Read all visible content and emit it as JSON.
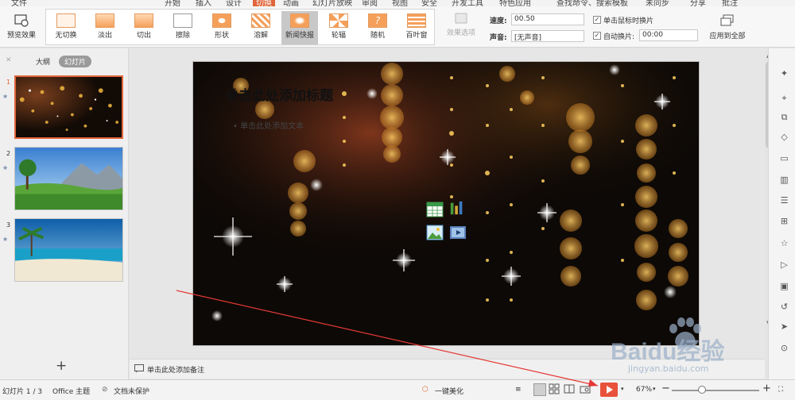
{
  "menu": {
    "items": [
      "文件",
      "开始",
      "插入",
      "设计",
      "切换",
      "动画",
      "幻灯片放映",
      "审阅",
      "视图",
      "安全",
      "开发工具",
      "特色应用"
    ],
    "active_index": 4,
    "search": "查找命令、搜索模板",
    "right": [
      "未同步",
      "分享",
      "批注"
    ]
  },
  "ribbon": {
    "preview_label": "预览效果",
    "transitions": [
      {
        "label": "无切换",
        "selected": false
      },
      {
        "label": "淡出",
        "selected": false
      },
      {
        "label": "切出",
        "selected": false
      },
      {
        "label": "擦除",
        "selected": false
      },
      {
        "label": "形状",
        "selected": false
      },
      {
        "label": "溶解",
        "selected": false
      },
      {
        "label": "新闻快报",
        "selected": true
      },
      {
        "label": "轮辐",
        "selected": false
      },
      {
        "label": "随机",
        "selected": false
      },
      {
        "label": "百叶窗",
        "selected": false
      }
    ],
    "effect_options": "效果选项",
    "speed_label": "速度:",
    "speed_value": "00.50",
    "sound_label": "声音:",
    "sound_value": "[无声音]",
    "click_switch": "单击鼠标时换片",
    "auto_switch": "自动换片:",
    "auto_value": "00:00",
    "apply_all": "应用到全部"
  },
  "left_pane": {
    "tab_outline": "大纲",
    "tab_slides": "幻灯片",
    "slides": [
      {
        "num": "1",
        "theme": "sparkle"
      },
      {
        "num": "2",
        "theme": "landscape"
      },
      {
        "num": "3",
        "theme": "beach"
      }
    ],
    "current": 1,
    "add_button": "+"
  },
  "slide": {
    "title": "单击此处添加标题",
    "subtitle": "• 单击此处添加文本"
  },
  "notes_placeholder": "单击此处添加备注",
  "status": {
    "slide_info": "幻灯片 1 / 3",
    "theme": "Office 主题",
    "protect": "文档未保护",
    "beautify": "一键美化",
    "zoom": "67%",
    "zoom_fraction": 0.3
  },
  "watermark": {
    "brand": "Baidu经验",
    "url": "jingyan.baidu.com"
  },
  "colors": {
    "accent": "#e0653a",
    "play": "#e8513a",
    "annotation_line": "#e53935"
  }
}
